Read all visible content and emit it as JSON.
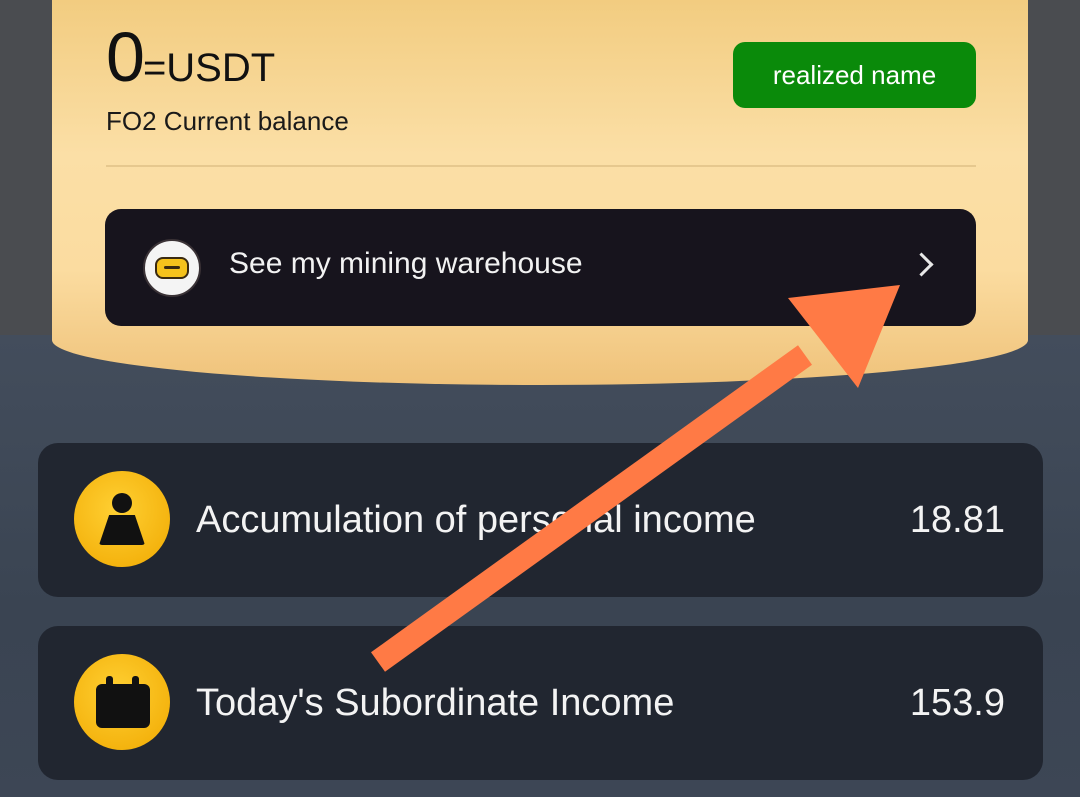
{
  "balance": {
    "value": "0",
    "unit": "=USDT",
    "label": "FO2 Current balance",
    "realized_button_label": "realized name"
  },
  "warehouse": {
    "label": "See my mining warehouse",
    "icon": "robot-icon"
  },
  "income": [
    {
      "icon": "person-icon",
      "label": "Accumulation of personal income",
      "value": "18.81"
    },
    {
      "icon": "calendar-icon",
      "label": "Today's Subordinate Income",
      "value": "153.9"
    }
  ],
  "colors": {
    "realized_button": "#0a8a0a",
    "card_gold": "#fbdca0",
    "dark_button": "#17141d",
    "income_card": "#212630",
    "icon_yellow": "#ffc61a",
    "annotation_arrow": "#ff7a45"
  }
}
